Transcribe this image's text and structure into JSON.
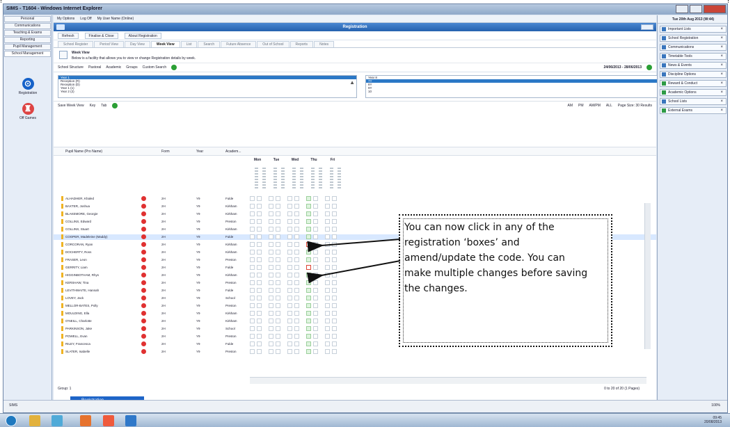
{
  "window": {
    "title": "SIMS - T1604 - Windows Internet Explorer"
  },
  "left_nav": {
    "items": [
      "Personal",
      "Communications",
      "Teaching & Exams",
      "Reporting",
      "Pupil Management",
      "School Management"
    ],
    "tiles": [
      {
        "label": "Registration"
      },
      {
        "label": "Off Games"
      }
    ]
  },
  "main": {
    "top_links": [
      "My Options",
      "Log Off",
      "My User Name (Online)"
    ],
    "header": "Registration",
    "toolbar": [
      "Refresh",
      "Finalise & Close",
      "About Registration"
    ],
    "tabs": [
      "School Register",
      "Period View",
      "Day View",
      "Week View",
      "List",
      "Search",
      "Future Absence",
      "Out of School",
      "Reports",
      "Notes"
    ],
    "week_view": {
      "title": "Week View",
      "description": "Below is a facility that allows you to view or change Registration details by week."
    },
    "filters": [
      "School Structure",
      "Pastoral",
      "Academic",
      "Groups",
      "Custom Search"
    ],
    "date_range": "24/06/2013 - 28/06/2013",
    "left_list": [
      "Year 1",
      "Reception (R)",
      "Reception (D)",
      "Year 1 (1)",
      "Year 2 (2)"
    ],
    "right_list": [
      "Year 8",
      "7Y",
      "8Y",
      "9Y",
      "10"
    ],
    "grid_tools": [
      "Save Week View",
      "Key",
      "Tab"
    ],
    "view_buttons": [
      "AM",
      "PM",
      "AM/PM",
      "ALL",
      "Page Size: 30 Results"
    ],
    "columns": [
      "Pupil Name (Pro Name)",
      "Form",
      "Year",
      "Academ..."
    ],
    "days": [
      "Mon",
      "Tue",
      "Wed",
      "Thu",
      "Fri"
    ],
    "rows": [
      {
        "name": "ALHADHER, Khaled",
        "form": "2H",
        "year": "Y9",
        "academy": "Fulde"
      },
      {
        "name": "BAXTER, Joshua",
        "form": "2H",
        "year": "Y9",
        "academy": "Kirkham"
      },
      {
        "name": "BLAKEMORE, Georgie",
        "form": "2H",
        "year": "Y9",
        "academy": "Kirkham"
      },
      {
        "name": "COLLINS, Edward",
        "form": "2H",
        "year": "Y9",
        "academy": "Preston"
      },
      {
        "name": "COLLINS, Stuart",
        "form": "2H",
        "year": "Y9",
        "academy": "Kirkham"
      },
      {
        "name": "COOPER, Madeleine (Maddy)",
        "form": "2H",
        "year": "Y9",
        "academy": "Fulde"
      },
      {
        "name": "CORCORAN, Ryan",
        "form": "2H",
        "year": "Y9",
        "academy": "Kirkham"
      },
      {
        "name": "DOCHERTY, Ross",
        "form": "2H",
        "year": "Y9",
        "academy": "Kirkham"
      },
      {
        "name": "FRASER, Leon",
        "form": "2H",
        "year": "Y9",
        "academy": "Preston"
      },
      {
        "name": "GERRITY, Liam",
        "form": "2H",
        "year": "Y9",
        "academy": "Fulde"
      },
      {
        "name": "HIGGINBOTHAM, Rhys",
        "form": "2H",
        "year": "Y9",
        "academy": "Kirkham"
      },
      {
        "name": "KERSHAW, Tina",
        "form": "2H",
        "year": "Y9",
        "academy": "Preston"
      },
      {
        "name": "LEVITHWAITE, Hannah",
        "form": "2H",
        "year": "Y9",
        "academy": "Fulde"
      },
      {
        "name": "LOVEY, Jack",
        "form": "2H",
        "year": "Y9",
        "academy": "School"
      },
      {
        "name": "MELLOR-BATES, Polly",
        "form": "2H",
        "year": "Y9",
        "academy": "Preston"
      },
      {
        "name": "MOULDING, Ella",
        "form": "2H",
        "year": "Y9",
        "academy": "Kirkham"
      },
      {
        "name": "O'NEILL, Charlotte",
        "form": "2H",
        "year": "Y9",
        "academy": "Kirkham"
      },
      {
        "name": "PARKINSON, Jake",
        "form": "2H",
        "year": "Y9",
        "academy": "School"
      },
      {
        "name": "POWELL, Evan",
        "form": "2H",
        "year": "Y9",
        "academy": "Preston"
      },
      {
        "name": "RILEY, Francesca",
        "form": "2H",
        "year": "Y9",
        "academy": "Fulde"
      },
      {
        "name": "SLATER, Isabelle",
        "form": "2H",
        "year": "Y9",
        "academy": "Preston"
      }
    ],
    "group_label": "Group: 1",
    "paging": "0 to 20 of 20 (1 Pages)",
    "bottom_tab": "Registration"
  },
  "right_panel": {
    "header": "Tue 20th Aug 2013 (W:44)",
    "items": [
      "Important Lists",
      "School Registration",
      "Communications",
      "Timetable Tools",
      "News & Events",
      "Discipline Options",
      "Reward & Conduct",
      "Academic Options",
      "School Lists",
      "External Exams"
    ]
  },
  "status": {
    "left": "SIMS",
    "zoom": "100%"
  },
  "taskbar": {
    "time": "09:45",
    "date": "20/08/2013"
  },
  "callout": {
    "text": "You can now click in any of the registration ‘boxes’ and amend/update the code. You can make multiple changes before saving the changes."
  }
}
